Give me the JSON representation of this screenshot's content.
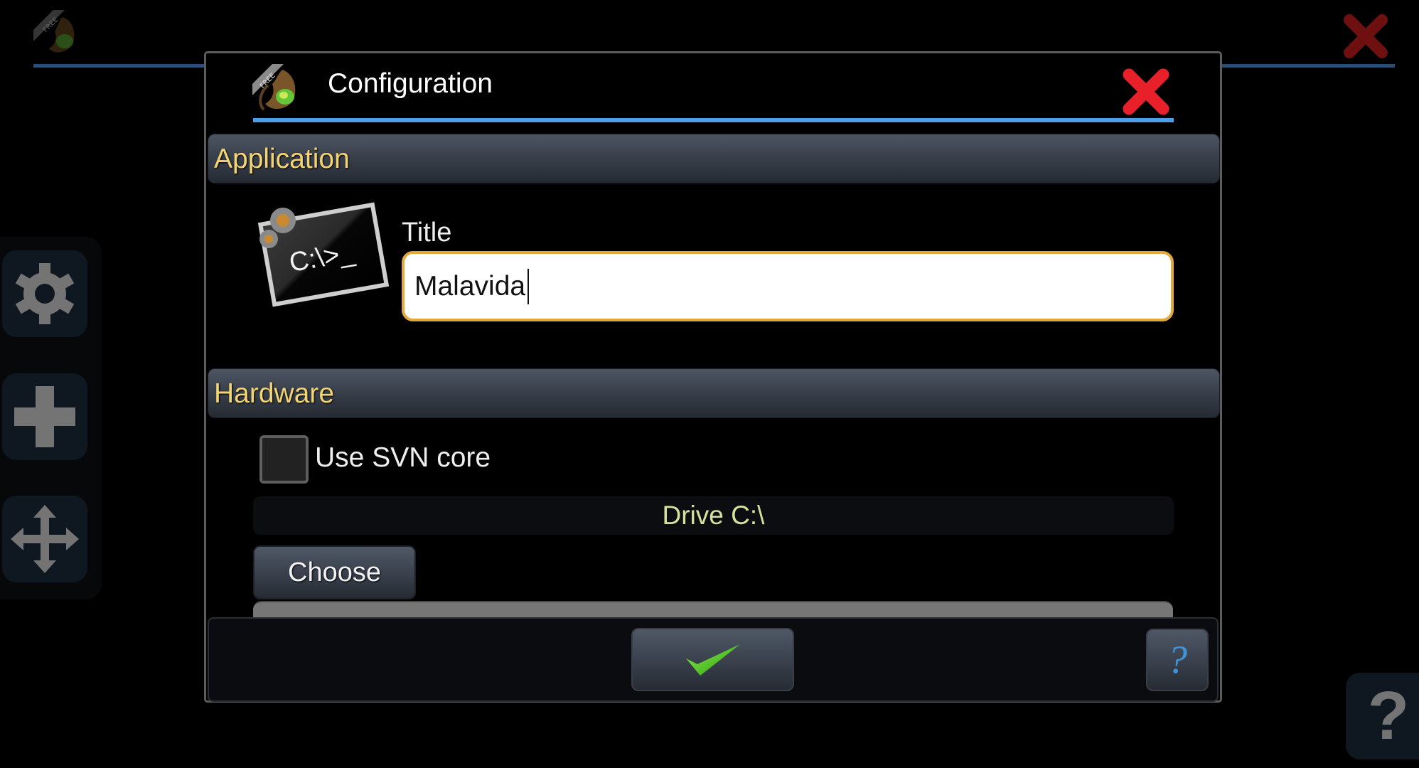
{
  "background": {
    "logo_icon": "dragon-logo-icon",
    "logo_badge": "FREE",
    "close_icon": "close-icon",
    "sidebar": {
      "items": [
        {
          "name": "settings",
          "icon": "gear-icon"
        },
        {
          "name": "add",
          "icon": "plus-icon"
        },
        {
          "name": "move",
          "icon": "move-arrows-icon"
        }
      ]
    },
    "help_label": "?"
  },
  "dialog": {
    "title": "Configuration",
    "logo_badge": "FREE",
    "close_icon": "close-icon",
    "sections": {
      "application": {
        "label": "Application",
        "icon": "terminal-icon",
        "icon_text": "C:\\>_",
        "title_label": "Title",
        "title_value": "Malavida"
      },
      "hardware": {
        "label": "Hardware",
        "use_svn_core": {
          "label": "Use SVN core",
          "checked": false
        },
        "drive_label": "Drive C:\\",
        "choose_label": "Choose"
      }
    },
    "footer": {
      "ok_icon": "checkmark-icon",
      "help_label": "?"
    },
    "colors": {
      "accent_blue": "#4aa0e8",
      "section_text": "#f2d474",
      "input_border": "#e4a93c",
      "close_red": "#e8202a",
      "drive_text": "#d6e29b",
      "check_green": "#44c01c"
    }
  }
}
